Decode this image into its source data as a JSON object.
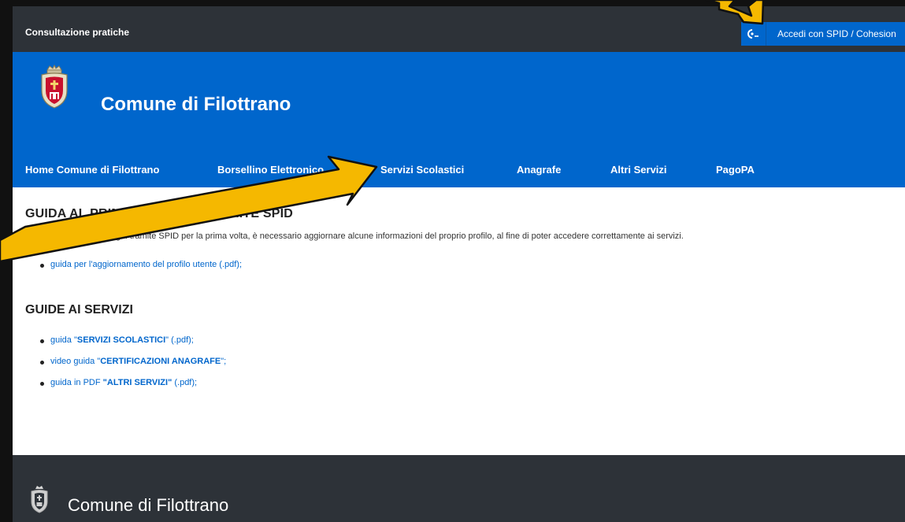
{
  "topbar": {
    "title": "Consultazione pratiche",
    "login_button": "Accedi con SPID / Cohesion"
  },
  "header": {
    "site_title": "Comune di Filottrano"
  },
  "nav": {
    "items": [
      {
        "label": "Home Comune di Filottrano"
      },
      {
        "label": "Borsellino Elettronico"
      },
      {
        "label": "Servizi Scolastici"
      },
      {
        "label": "Anagrafe"
      },
      {
        "label": "Altri Servizi"
      },
      {
        "label": "PagoPA"
      }
    ]
  },
  "guide_spid": {
    "heading": "GUIDA AL PRIMO ACCESSO TRAMITE SPID",
    "intro": "Dopo aver eseguito il login tramite SPID per la prima volta, è necessario aggiornare alcune informazioni del proprio profilo, al fine di poter accedere correttamente ai servizi.",
    "link": "guida per l'aggiornamento del profilo utente (.pdf);"
  },
  "guide_servizi": {
    "heading": "GUIDE AI SERVIZI",
    "items": [
      {
        "prefix": "guida \"",
        "bold": "SERVIZI SCOLASTICI",
        "suffix": "\" (.pdf);"
      },
      {
        "prefix": "video guida \"",
        "bold": "CERTIFICAZIONI ANAGRAFE",
        "suffix": "\";"
      },
      {
        "prefix": "guida in PDF ",
        "bold": "\"ALTRI SERVIZI\"",
        "suffix": " (.pdf);"
      }
    ]
  },
  "footer": {
    "site_title": "Comune di Filottrano"
  },
  "colors": {
    "primary": "#0066cc",
    "dark": "#2d3238",
    "arrow": "#f5b800"
  },
  "icons": {
    "login": "spid-login-icon",
    "logo": "coat-of-arms-icon"
  }
}
